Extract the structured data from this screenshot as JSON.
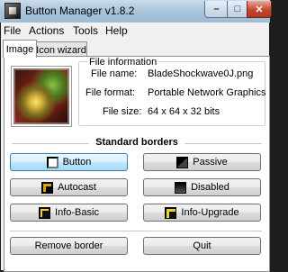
{
  "window": {
    "title": "Button Manager v1.8.2",
    "controls": {
      "minimize": "–",
      "maximize": "□",
      "close": "✕"
    }
  },
  "menu": [
    "File",
    "Actions",
    "Tools",
    "Help"
  ],
  "tabs": [
    {
      "label": "Image",
      "active": true
    },
    {
      "label": "Icon wizard",
      "active": false
    }
  ],
  "file_info": {
    "heading": "File information",
    "rows": [
      {
        "label": "File name:",
        "value": "BladeShockwave0J.png"
      },
      {
        "label": "File format:",
        "value": "Portable Network Graphics"
      },
      {
        "label": "File size:",
        "value": "64 x 64 x 32 bits"
      }
    ]
  },
  "borders": {
    "heading": "Standard borders",
    "buttons": [
      {
        "label": "Button",
        "icon": "button-border-icon",
        "focused": true
      },
      {
        "label": "Passive",
        "icon": "passive-border-icon"
      },
      {
        "label": "Autocast",
        "icon": "autocast-border-icon"
      },
      {
        "label": "Disabled",
        "icon": "disabled-border-icon"
      },
      {
        "label": "Info-Basic",
        "icon": "info-basic-border-icon"
      },
      {
        "label": "Info-Upgrade",
        "icon": "info-upgrade-border-icon"
      }
    ]
  },
  "actions": {
    "remove_border": "Remove border",
    "quit": "Quit"
  },
  "colors": {
    "titlebar": "#a9c4d9",
    "close_button": "#c7462d",
    "focused_button": "#bee6fd"
  }
}
